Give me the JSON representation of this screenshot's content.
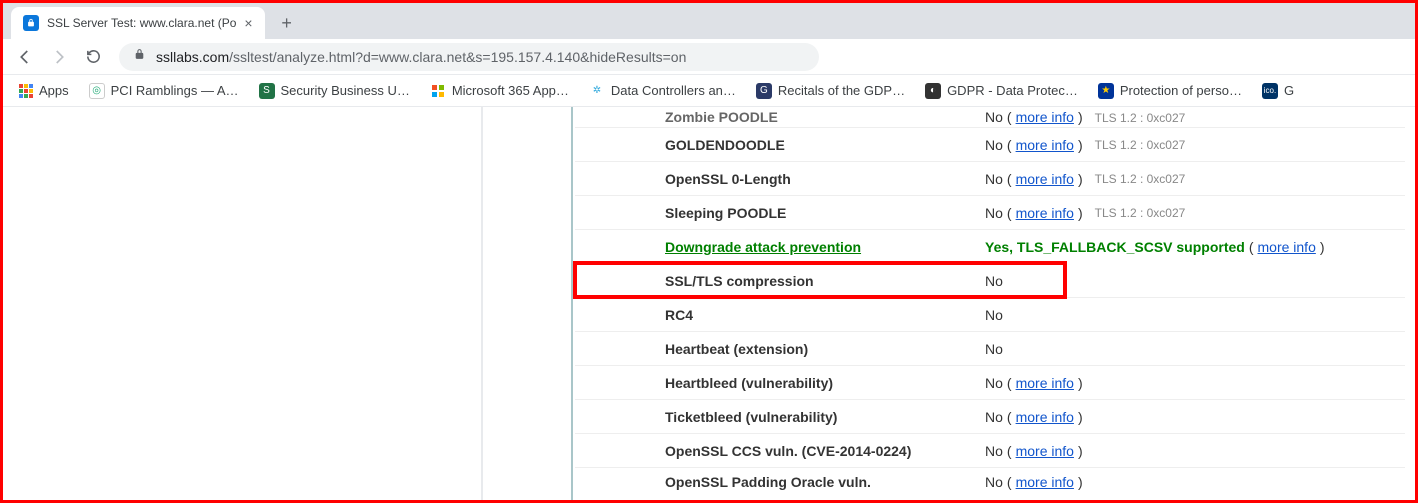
{
  "tab": {
    "title": "SSL Server Test: www.clara.net (Po"
  },
  "url": {
    "domain": "ssllabs.com",
    "path": "/ssltest/analyze.html?d=www.clara.net&s=195.157.4.140&hideResults=on"
  },
  "bookmarks": {
    "apps": "Apps",
    "items": [
      {
        "label": "PCI Ramblings — A…",
        "bg": "#ffffff",
        "fg": "#2a7"
      },
      {
        "label": "Security Business U…",
        "bg": "#217346",
        "fg": "#fff"
      },
      {
        "label": "Microsoft 365 App…",
        "bg": "#ffffff",
        "fg": "#000"
      },
      {
        "label": "Data Controllers an…",
        "bg": "#ffffff",
        "fg": "#3ad"
      },
      {
        "label": "Recitals of the GDP…",
        "bg": "#2b3a67",
        "fg": "#fff"
      },
      {
        "label": "GDPR - Data Protec…",
        "bg": "#333333",
        "fg": "#fff"
      },
      {
        "label": "Protection of perso…",
        "bg": "#003399",
        "fg": "#ffcc00"
      },
      {
        "label": "G",
        "bg": "#003366",
        "fg": "#fff",
        "text": "ico."
      }
    ]
  },
  "rows": [
    {
      "label": "Zombie POODLE",
      "status": "No",
      "more": "more info",
      "meta": "TLS 1.2 : 0xc027",
      "partial": "top"
    },
    {
      "label": "GOLDENDOODLE",
      "status": "No",
      "more": "more info",
      "meta": "TLS 1.2 : 0xc027"
    },
    {
      "label": "OpenSSL 0-Length",
      "status": "No",
      "more": "more info",
      "meta": "TLS 1.2 : 0xc027"
    },
    {
      "label": "Sleeping POODLE",
      "status": "No",
      "more": "more info",
      "meta": "TLS 1.2 : 0xc027"
    },
    {
      "label": "Downgrade attack prevention",
      "status": "Yes, TLS_FALLBACK_SCSV supported",
      "more": "more info",
      "green": true
    },
    {
      "label": "SSL/TLS compression",
      "status": "No",
      "highlight": true
    },
    {
      "label": "RC4",
      "status": "No"
    },
    {
      "label": "Heartbeat (extension)",
      "status": "No"
    },
    {
      "label": "Heartbleed (vulnerability)",
      "status": "No",
      "more": "more info"
    },
    {
      "label": "Ticketbleed (vulnerability)",
      "status": "No",
      "more": "more info"
    },
    {
      "label": "OpenSSL CCS vuln. (CVE-2014-0224)",
      "status": "No",
      "more": "more info"
    },
    {
      "label": "OpenSSL Padding Oracle vuln.",
      "status": "No",
      "more": "more info",
      "partial": "bottom"
    }
  ],
  "more_info_label": "more info"
}
